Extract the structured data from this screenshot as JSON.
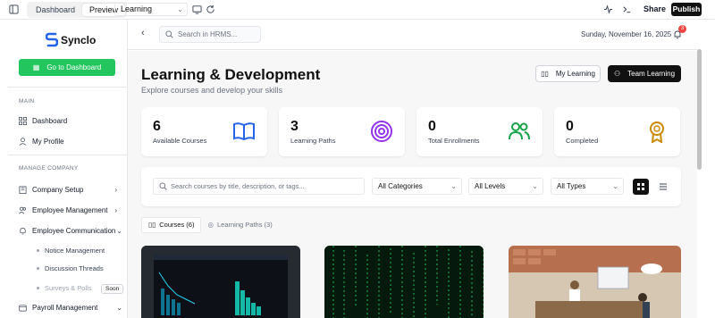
{
  "topbar": {
    "segments": [
      "Dashboard",
      "Preview"
    ],
    "active_segment": "Preview",
    "route_select": "Learning",
    "share_label": "Share",
    "publish_label": "Publish"
  },
  "sidebar": {
    "brand": "Synclo",
    "goto_label": "Go to Dashboard",
    "main_label": "MAIN",
    "main_items": [
      {
        "label": "Dashboard",
        "icon": "grid-icon"
      },
      {
        "label": "My Profile",
        "icon": "user-icon"
      }
    ],
    "manage_label": "MANAGE COMPANY",
    "manage_items": [
      {
        "label": "Company Setup",
        "icon": "building-icon",
        "chevron": "›"
      },
      {
        "label": "Employee Management",
        "icon": "users-icon",
        "chevron": "›"
      },
      {
        "label": "Employee Communication",
        "icon": "bell-icon",
        "chevron": "⌄"
      }
    ],
    "sub_items": [
      {
        "label": "Notice Management"
      },
      {
        "label": "Discussion Threads"
      },
      {
        "label": "Surveys & Polls"
      }
    ],
    "soon_badge": "Soon",
    "payroll_item": {
      "label": "Payroll Management",
      "chevron": "⌄"
    }
  },
  "header": {
    "search_placeholder": "Search in HRMS...",
    "date": "Sunday, November 16, 2025",
    "notification_count": "3"
  },
  "page": {
    "title": "Learning & Development",
    "subtitle": "Explore courses and develop your skills",
    "my_learning": "My Learning",
    "team_learning": "Team Learning"
  },
  "stats": [
    {
      "value": "6",
      "label": "Available Courses",
      "icon": "book-icon",
      "color": "#2563eb"
    },
    {
      "value": "3",
      "label": "Learning Paths",
      "icon": "target-icon",
      "color": "#9333ea"
    },
    {
      "value": "0",
      "label": "Total Enrollments",
      "icon": "users-icon",
      "color": "#16a34a"
    },
    {
      "value": "0",
      "label": "Completed",
      "icon": "award-icon",
      "color": "#ca8a04"
    }
  ],
  "filters": {
    "search_placeholder": "Search courses by title, description, or tags...",
    "category": "All Categories",
    "level": "All Levels",
    "type": "All Types"
  },
  "tabs": [
    {
      "label": "Courses (6)",
      "active": true
    },
    {
      "label": "Learning Paths (3)",
      "active": false
    }
  ],
  "colors": {
    "accent_green": "#22c55e",
    "dark": "#111111",
    "notification": "#ef4444"
  }
}
